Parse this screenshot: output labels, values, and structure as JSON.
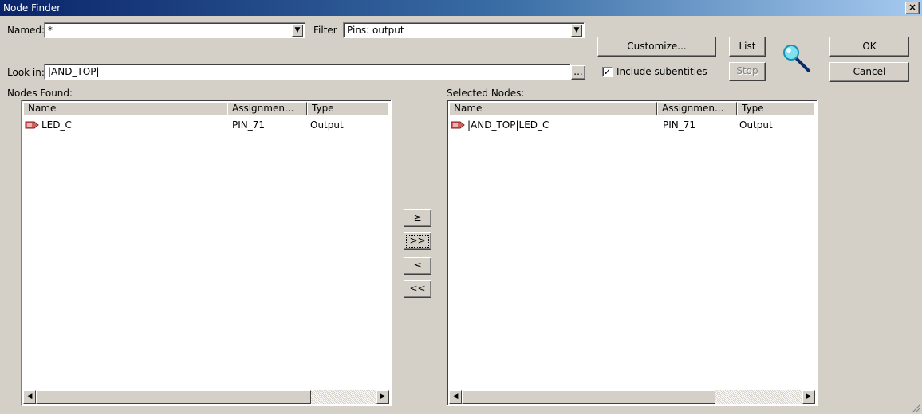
{
  "window": {
    "title": "Node Finder",
    "close": "×"
  },
  "named": {
    "label": "Named:",
    "value": "*"
  },
  "filter": {
    "label": "Filter",
    "value": "Pins: output"
  },
  "look_in": {
    "label": "Look in:",
    "value": "|AND_TOP|",
    "browse": "..."
  },
  "include_subentities": {
    "label": "Include subentities",
    "checked": true,
    "mark": "✓"
  },
  "buttons": {
    "customize": "Customize...",
    "list": "List",
    "stop": "Stop",
    "ok": "OK",
    "cancel": "Cancel"
  },
  "transfer": {
    "add": "≥",
    "add_all": ">>",
    "remove": "≤",
    "remove_all": "<<"
  },
  "nodes_found": {
    "label": "Nodes Found:",
    "columns": [
      "Name",
      "Assignmen...",
      "Type"
    ],
    "rows": [
      {
        "name": "LED_C",
        "assignment": "PIN_71",
        "type": "Output"
      }
    ]
  },
  "selected_nodes": {
    "label": "Selected Nodes:",
    "columns": [
      "Name",
      "Assignmen...",
      "Type"
    ],
    "rows": [
      {
        "name": "|AND_TOP|LED_C",
        "assignment": "PIN_71",
        "type": "Output"
      }
    ]
  },
  "icons": {
    "search": "magnifier-icon",
    "pin": "output-pin-icon"
  }
}
